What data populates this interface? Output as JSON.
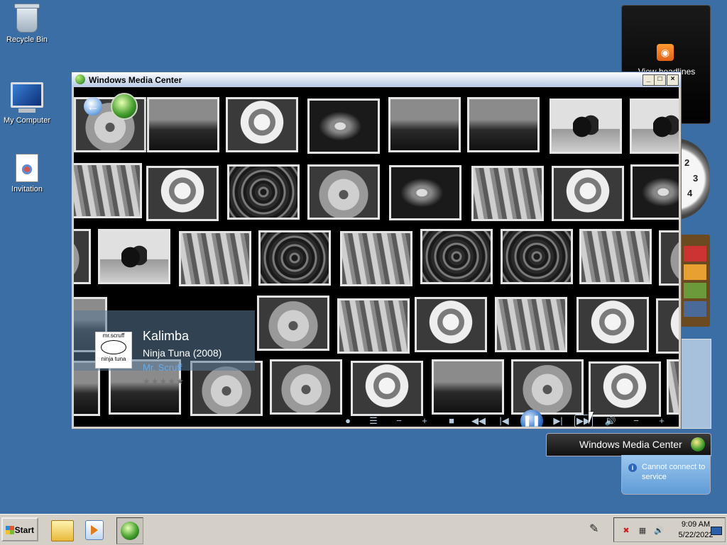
{
  "desktop": {
    "icons": [
      {
        "label": "Recycle Bin"
      },
      {
        "label": "My Computer"
      },
      {
        "label": "Invitation"
      }
    ]
  },
  "gadgets": {
    "feed": {
      "label": "View headlines"
    },
    "clock_numbers": [
      "2",
      "3",
      "4"
    ]
  },
  "window": {
    "title": "Windows Media Center",
    "controls": {
      "minimize": "_",
      "maximize": "□",
      "close": "×"
    }
  },
  "now_playing": {
    "song": "Kalimba",
    "album": "Ninja Tuna (2008)",
    "artist": "Mr. Scruff",
    "rating": "★★★★★",
    "album_art_top": "mr.scruff",
    "album_art_bottom": "ninja tuna"
  },
  "transport": {
    "buttons": [
      "●",
      "☰",
      "−",
      "+",
      "■",
      "◀◀",
      "|◀",
      "❚❚",
      "▶|",
      "▶▶",
      "🔊",
      "−",
      "+"
    ]
  },
  "notification": {
    "brand": "Windows Media Center",
    "message": "Cannot connect to service",
    "info_symbol": "i"
  },
  "taskbar": {
    "start_label": "Start",
    "time": "9:09 AM",
    "date": "5/22/2022"
  },
  "colors": {
    "desktop": "#3a6ea5",
    "accent_blue": "#6aa9e8"
  }
}
